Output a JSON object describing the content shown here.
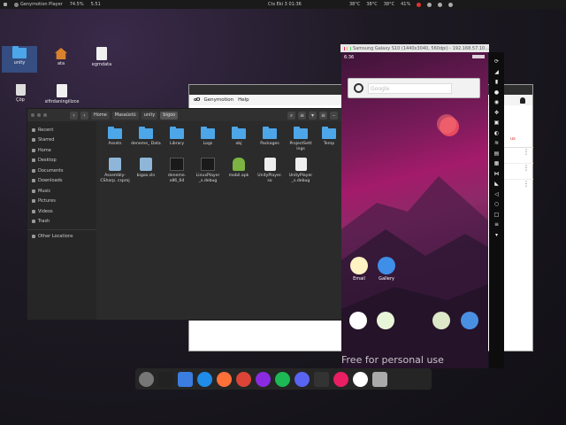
{
  "topbar": {
    "app_name": "Genymotion Player",
    "battery_pct": "74.5%",
    "mem_value": "5.51",
    "datetime": "Cts Eki 3  01:36",
    "tray": [
      "38°C",
      "38°C",
      "38°C",
      "41%"
    ]
  },
  "desktop_icons": [
    {
      "label": "unity",
      "type": "folder"
    },
    {
      "label": "ata",
      "type": "home"
    },
    {
      "label": "egmdata",
      "type": "doc"
    },
    {
      "label": "Çöp",
      "type": "trash"
    },
    {
      "label": "sifirdaningilizce",
      "type": "doc"
    }
  ],
  "file_manager": {
    "breadcrumbs": [
      "Home",
      "Masaüstü",
      "unity",
      "bigoo"
    ],
    "sidebar": [
      "Recent",
      "Starred",
      "Home",
      "Desktop",
      "Documents",
      "Downloads",
      "Music",
      "Pictures",
      "Videos",
      "Trash",
      "Other Locations"
    ],
    "files_row1": [
      "Assets",
      "deneme_ Data",
      "Library",
      "Logs",
      "obj",
      "Packages",
      "ProjectSett ings",
      "Temp"
    ],
    "files_row2": [
      "Assembly- CSharp. csproj",
      "bigoo.sln",
      "deneme. x86_64",
      "LinuxPlayer _s.debug",
      "mobil.apk",
      "UnityPlayer. so",
      "UnityPlayer _s.debug"
    ]
  },
  "genymotion": {
    "menu": [
      "Genymotion",
      "Help"
    ]
  },
  "device": {
    "title": "Samsung Galaxy S10 (1440x3040, 560dpi) - 192.168.57.10...",
    "time": "6:36",
    "search_placeholder": "Google",
    "apps": [
      "Email",
      "Gallery"
    ],
    "watermark": "Free for personal use"
  },
  "colors": {
    "folder": "#4da6e8",
    "dock_bg": "#252525",
    "phone_accent": "#a31b6a"
  }
}
